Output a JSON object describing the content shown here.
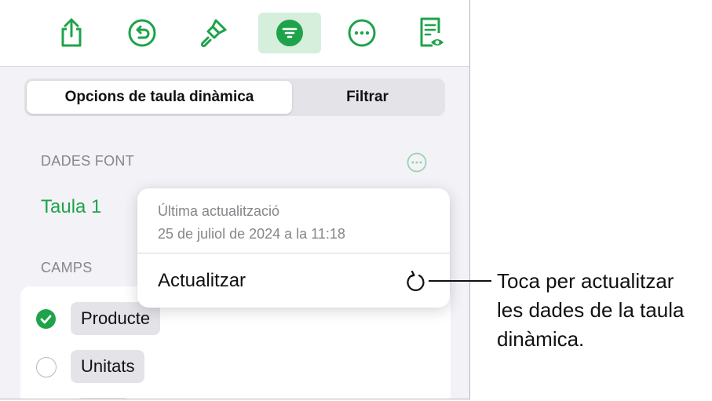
{
  "toolbar": {
    "icons": [
      "share-icon",
      "undo-icon",
      "format-brush-icon",
      "organize-icon",
      "more-icon",
      "reader-view-icon"
    ],
    "accent": "#1ea34a",
    "active_background": "#d5efdc"
  },
  "tabs": {
    "selected_label": "Opcions de taula dinàmica",
    "other_label": "Filtrar"
  },
  "source": {
    "section_label": "DADES FONT",
    "table_name": "Taula 1",
    "more_icon": "ellipsis-circle-icon"
  },
  "popover": {
    "title": "Última actualització",
    "date": "25 de juliol de 2024 a la 11:18",
    "action_label": "Actualitzar",
    "action_icon": "refresh-icon"
  },
  "fields": {
    "section_label": "CAMPS",
    "items": [
      {
        "label": "Producte",
        "checked": true
      },
      {
        "label": "Unitats",
        "checked": false
      }
    ]
  },
  "callout": {
    "lines": [
      "Toca per actualitzar",
      "les dades de la taula",
      "dinàmica."
    ]
  }
}
